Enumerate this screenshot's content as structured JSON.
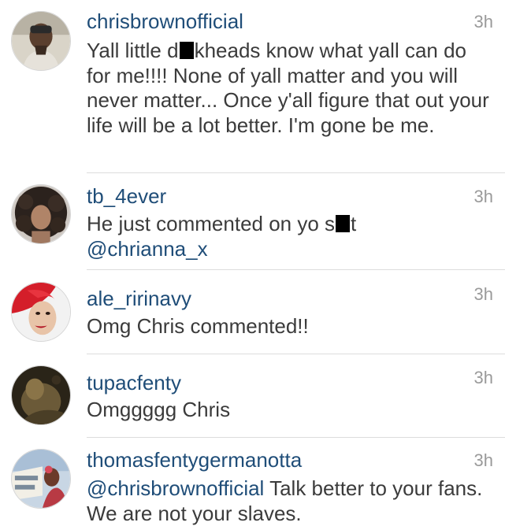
{
  "comments": [
    {
      "username": "chrisbrownofficial",
      "time": "3h",
      "text_before": "Yall little d",
      "text_after": "kheads know what yall can do for me!!!! None of yall matter and you will never matter... Once y'all figure that out your life will be a lot better. I'm gone be me."
    },
    {
      "username": "tb_4ever",
      "time": "3h",
      "text_before": "He just commented on yo s",
      "text_after": "t",
      "mention": "@chrianna_x"
    },
    {
      "username": "ale_ririnavy",
      "time": "3h",
      "text": "Omg Chris commented!!"
    },
    {
      "username": "tupacfenty",
      "time": "3h",
      "text": "Omggggg Chris"
    },
    {
      "username": "thomasfentygermanotta",
      "time": "3h",
      "mention": "@chrisbrownofficial",
      "text": " Talk better to your fans. We are not your slaves."
    }
  ],
  "colors": {
    "username": "#1f4d78",
    "text": "#3b3b3b",
    "timestamp": "#9a9a9a",
    "divider": "#dcdcdc"
  }
}
